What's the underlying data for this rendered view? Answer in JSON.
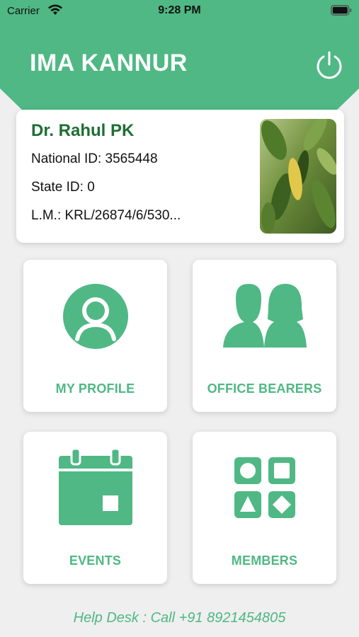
{
  "status_bar": {
    "carrier": "Carrier",
    "time": "9:28 PM",
    "wifi_icon": "wifi-icon",
    "battery_icon": "battery-icon"
  },
  "header": {
    "title": "IMA KANNUR",
    "power_icon": "power-icon",
    "background_color": "#4fb884"
  },
  "profile": {
    "name": "Dr. Rahul PK",
    "national_id": "National ID: 3565448",
    "state_id": "State ID: 0",
    "lm_number": "L.M.: KRL/26874/6/530..."
  },
  "menu": {
    "items": [
      {
        "label": "MY PROFILE",
        "icon": "user-avatar-icon"
      },
      {
        "label": "OFFICE BEARERS",
        "icon": "people-icon"
      },
      {
        "label": "EVENTS",
        "icon": "calendar-icon"
      },
      {
        "label": "MEMBERS",
        "icon": "shapes-grid-icon"
      }
    ]
  },
  "footer": {
    "help_desk": "Help Desk : Call +91 8921454805"
  },
  "colors": {
    "accent": "#4fb884",
    "name_color": "#1f6e34",
    "background": "#efefef"
  }
}
